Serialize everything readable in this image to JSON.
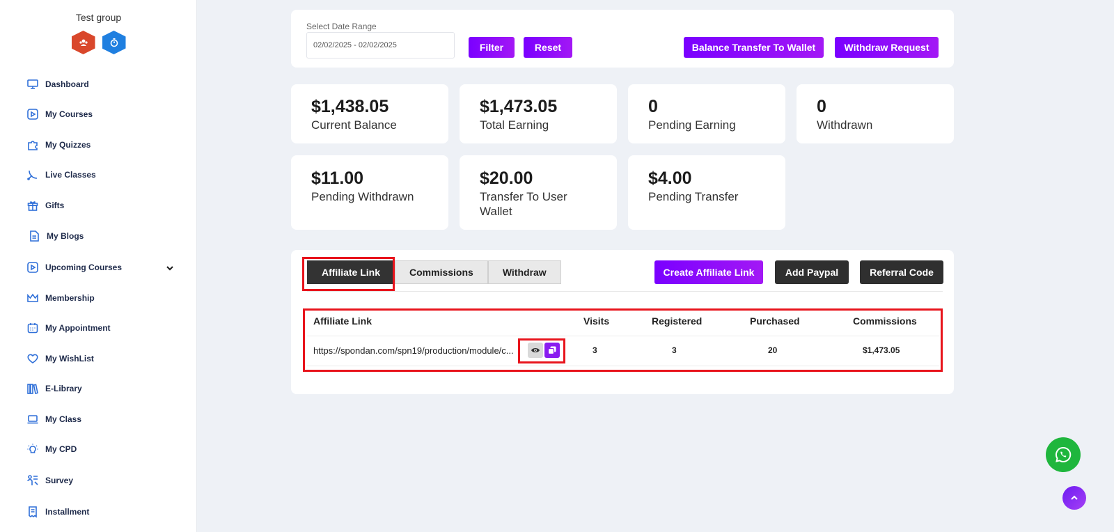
{
  "sidebar": {
    "group_title": "Test group",
    "badges": [
      {
        "icon": "users-badge-icon",
        "color": "#d9472b"
      },
      {
        "icon": "timer-badge-icon",
        "color": "#1f7fe0"
      }
    ],
    "items": [
      {
        "label": "Dashboard",
        "icon": "monitor-icon"
      },
      {
        "label": "My Courses",
        "icon": "play-square-icon"
      },
      {
        "label": "My Quizzes",
        "icon": "puzzle-icon"
      },
      {
        "label": "Live Classes",
        "icon": "satellite-icon"
      },
      {
        "label": "Gifts",
        "icon": "gift-icon"
      },
      {
        "label": "My Blogs",
        "icon": "document-icon"
      },
      {
        "label": "Upcoming Courses",
        "icon": "play-square-icon"
      },
      {
        "label": "Membership",
        "icon": "crown-icon"
      },
      {
        "label": "My Appointment",
        "icon": "calendar-icon"
      },
      {
        "label": "My WishList",
        "icon": "heart-icon"
      },
      {
        "label": "E-Library",
        "icon": "books-icon"
      },
      {
        "label": "My Class",
        "icon": "laptop-icon"
      },
      {
        "label": "My CPD",
        "icon": "bulb-icon"
      },
      {
        "label": "Survey",
        "icon": "survey-icon"
      },
      {
        "label": "Installment",
        "icon": "receipt-icon"
      }
    ]
  },
  "filter": {
    "label": "Select Date Range",
    "date_value": "02/02/2025 - 02/02/2025",
    "filter_label": "Filter",
    "reset_label": "Reset",
    "transfer_label": "Balance Transfer To Wallet",
    "withdraw_label": "Withdraw Request"
  },
  "stats": [
    {
      "value": "$1,438.05",
      "label": "Current Balance"
    },
    {
      "value": "$1,473.05",
      "label": "Total Earning"
    },
    {
      "value": "0",
      "label": "Pending Earning"
    },
    {
      "value": "0",
      "label": "Withdrawn"
    },
    {
      "value": "$11.00",
      "label": "Pending Withdrawn"
    },
    {
      "value": "$20.00",
      "label": "Transfer To User Wallet"
    },
    {
      "value": "$4.00",
      "label": "Pending Transfer"
    }
  ],
  "affiliate": {
    "tabs": [
      "Affiliate Link",
      "Commissions",
      "Withdraw"
    ],
    "active_tab": "Affiliate Link",
    "create_label": "Create Affiliate Link",
    "paypal_label": "Add Paypal",
    "referral_label": "Referral Code",
    "columns": [
      "Affiliate Link",
      "Visits",
      "Registered",
      "Purchased",
      "Commissions"
    ],
    "rows": [
      {
        "link": "https://spondan.com/spn19/production/module/c...",
        "visits": "3",
        "registered": "3",
        "purchased": "20",
        "commissions": "$1,473.05"
      }
    ]
  },
  "colors": {
    "accent": "#7a00ff",
    "highlight": "#e8141c",
    "whatsapp": "#1fb63d"
  }
}
